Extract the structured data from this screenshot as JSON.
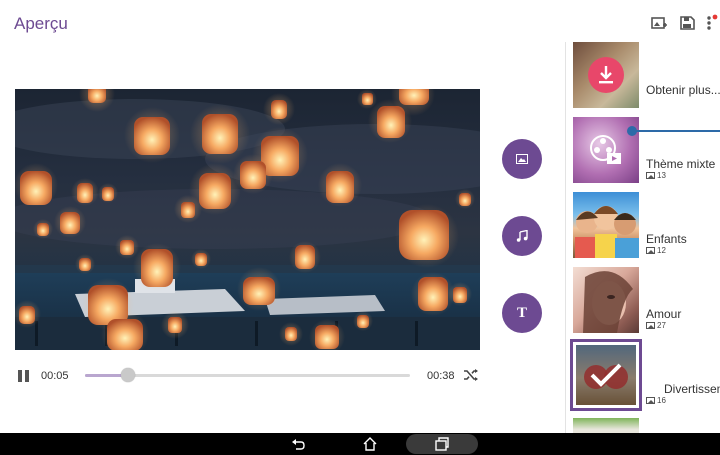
{
  "header": {
    "title": "Aperçu",
    "icons": [
      "add-to-gallery-icon",
      "save-icon",
      "more-menu-icon"
    ]
  },
  "player": {
    "current_time": "00:05",
    "total_time": "00:38",
    "progress_fraction": 0.13,
    "state": "playing"
  },
  "tools": [
    {
      "name": "image-icon"
    },
    {
      "name": "music-icon"
    },
    {
      "name": "text-icon",
      "glyph": "T"
    }
  ],
  "themes": [
    {
      "name": "Obtenir plus...",
      "count": "",
      "selected": false
    },
    {
      "name": "Thème mixte",
      "count": "13",
      "selected": false
    },
    {
      "name": "Enfants",
      "count": "12",
      "selected": false
    },
    {
      "name": "Amour",
      "count": "27",
      "selected": false
    },
    {
      "name": "Divertissement",
      "count": "16",
      "selected": true
    }
  ],
  "colors": {
    "accent": "#6d4a92",
    "download_badge": "#e8476a",
    "progress_blue": "#2d6aa8"
  }
}
